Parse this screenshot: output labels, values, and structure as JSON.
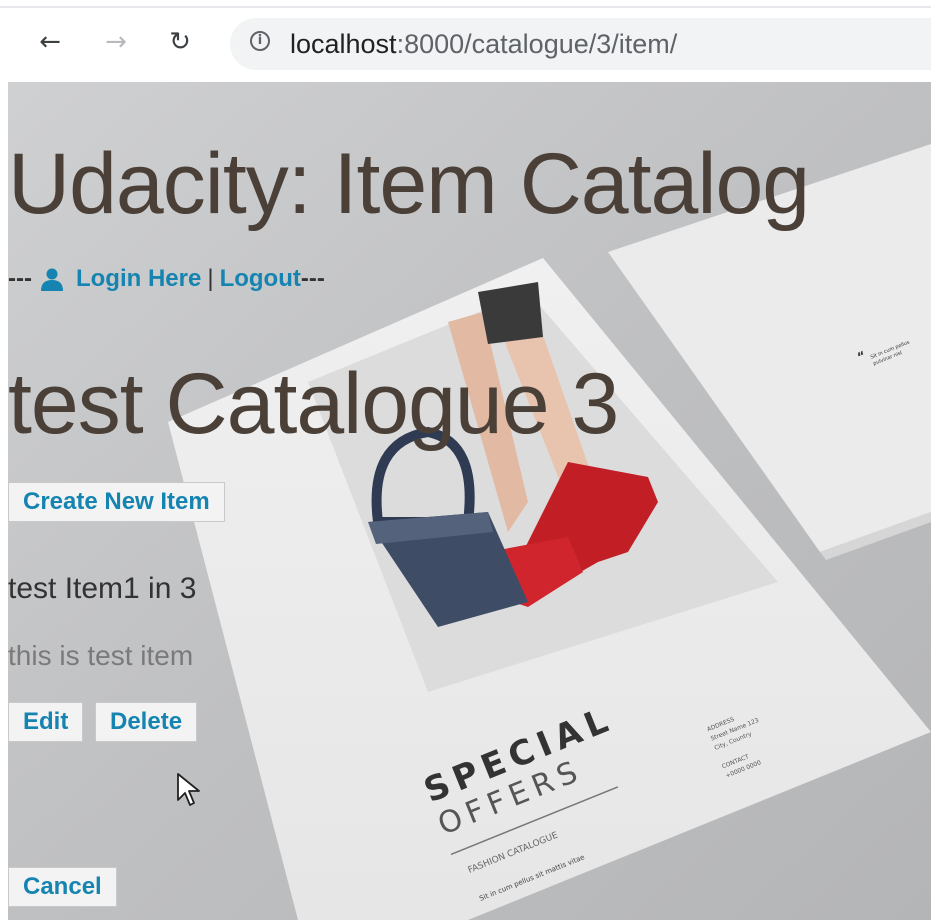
{
  "browser": {
    "url_host": "localhost",
    "url_path": ":8000/catalogue/3/item/"
  },
  "page": {
    "title": "Udacity: Item Catalog",
    "login_prefix": "---",
    "login_link": "Login Here",
    "separator": "|",
    "logout_link": "Logout",
    "login_suffix": "---",
    "catalogue_name": "test Catalogue 3",
    "create_button": "Create New Item",
    "item_name": "test Item1 in 3",
    "item_description": "this is test item",
    "edit_button": "Edit",
    "delete_button": "Delete",
    "cancel_button": "Cancel"
  },
  "colors": {
    "link": "#1584b0",
    "heading": "#4a4038",
    "button_bg": "#f3f3f3"
  },
  "icons": {
    "back": "arrow-left-icon",
    "forward": "arrow-right-icon",
    "reload": "reload-icon",
    "info": "info-icon",
    "user": "user-icon",
    "cursor": "mouse-cursor-icon"
  }
}
